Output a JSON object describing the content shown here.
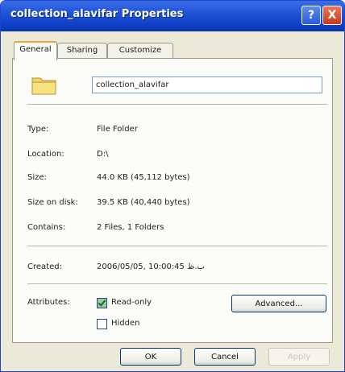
{
  "window": {
    "title": "collection_alavifar Properties",
    "help_icon": "?",
    "close_icon": "X"
  },
  "tabs": [
    {
      "label": "General"
    },
    {
      "label": "Sharing"
    },
    {
      "label": "Customize"
    }
  ],
  "general": {
    "folder_icon": "folder-icon",
    "name_value": "collection_alavifar",
    "fields": [
      {
        "label": "Type:",
        "value": "File Folder"
      },
      {
        "label": "Location:",
        "value": "D:\\"
      },
      {
        "label": "Size:",
        "value": "44.0 KB (45,112 bytes)"
      },
      {
        "label": "Size on disk:",
        "value": "39.5 KB (40,440 bytes)"
      },
      {
        "label": "Contains:",
        "value": "2 Files, 1 Folders"
      }
    ],
    "created": {
      "label": "Created:",
      "value": "2006/05/05, 10:00:45 ب.ظ"
    },
    "attributes": {
      "label": "Attributes:",
      "readonly_label": "Read-only",
      "readonly_checked": true,
      "hidden_label": "Hidden",
      "hidden_checked": false,
      "advanced_label": "Advanced..."
    }
  },
  "buttons": {
    "ok": "OK",
    "cancel": "Cancel",
    "apply": "Apply"
  }
}
